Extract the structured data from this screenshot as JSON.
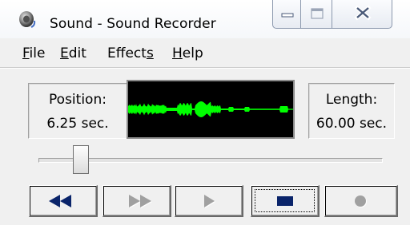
{
  "window": {
    "title": "Sound - Sound Recorder",
    "icon": "speaker-icon"
  },
  "caption_buttons": [
    "minimize-icon",
    "maximize-icon",
    "close-icon"
  ],
  "menu": [
    {
      "label": "File",
      "access_key": "F"
    },
    {
      "label": "Edit",
      "access_key": "E"
    },
    {
      "label": "Effects",
      "access_key": "s"
    },
    {
      "label": "Help",
      "access_key": "H"
    }
  ],
  "position": {
    "label": "Position:",
    "value": "6.25 sec."
  },
  "length": {
    "label": "Length:",
    "value": "60.00 sec."
  },
  "waveform": {
    "color": "#00ff00",
    "background": "#000000"
  },
  "slider": {
    "fraction": 0.104
  },
  "transport": [
    {
      "name": "seek-to-start-button",
      "icon": "rewind-icon",
      "enabled": true
    },
    {
      "name": "seek-to-end-button",
      "icon": "fast-forward-icon",
      "enabled": false
    },
    {
      "name": "play-button",
      "icon": "play-icon",
      "enabled": false
    },
    {
      "name": "stop-button",
      "icon": "stop-icon",
      "enabled": true,
      "focused": true
    },
    {
      "name": "record-button",
      "icon": "record-icon",
      "enabled": false
    }
  ],
  "colors": {
    "enabled_icon": "#0a246a",
    "disabled_icon": "#a0a0a0",
    "disabled_icon_shadow": "#ffffff"
  }
}
